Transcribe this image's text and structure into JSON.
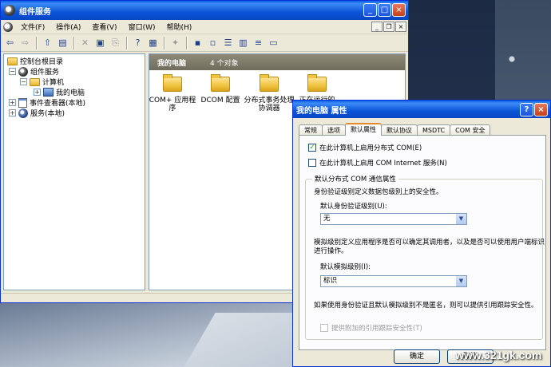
{
  "main_window": {
    "title": "组件服务",
    "menu": [
      "文件(F)",
      "操作(A)",
      "查看(V)",
      "窗口(W)",
      "帮助(H)"
    ],
    "tree": [
      {
        "label": "控制台根目录"
      },
      {
        "label": "组件服务"
      },
      {
        "label": "计算机"
      },
      {
        "label": "我的电脑"
      },
      {
        "label": "事件查看器(本地)"
      },
      {
        "label": "服务(本地)"
      }
    ],
    "list_header": {
      "title": "我的电脑",
      "count": "4 个对象"
    },
    "items": [
      {
        "label": "COM+ 应用程序"
      },
      {
        "label": "DCOM 配置"
      },
      {
        "label": "分布式事务处理协调器"
      },
      {
        "label": "正在运行的"
      }
    ]
  },
  "dialog": {
    "title": "我的电脑 属性",
    "help_button": "?",
    "close_button": "×",
    "tabs": [
      "常规",
      "选项",
      "默认属性",
      "默认协议",
      "MSDTC",
      "COM 安全"
    ],
    "active_tab": "默认属性",
    "check_enable_dcom": {
      "label": "在此计算机上启用分布式 COM(E)",
      "checked": true
    },
    "check_enable_internet": {
      "label": "在此计算机上启用 COM Internet 服务(N)",
      "checked": false
    },
    "group_title": "默认分布式 COM 通信属性",
    "auth_desc": "身份验证级别定义数据包级别上的安全性。",
    "auth_label": "默认身份验证级别(U):",
    "auth_value": "无",
    "imp_desc": "模拟级别定义应用程序是否可以确定其调用者，以及是否可以使用用户端标识进行操作。",
    "imp_label": "默认模拟级别(I):",
    "imp_value": "标识",
    "ref_desc": "如果使用身份验证且默认模拟级别不是匿名，则可以提供引用跟踪安全性。",
    "ref_check": {
      "label": "提供附加的引用跟踪安全性(T)",
      "checked": false
    },
    "ok_button": "确定",
    "cancel_button": "取消"
  },
  "watermark": "www.321gk.com"
}
